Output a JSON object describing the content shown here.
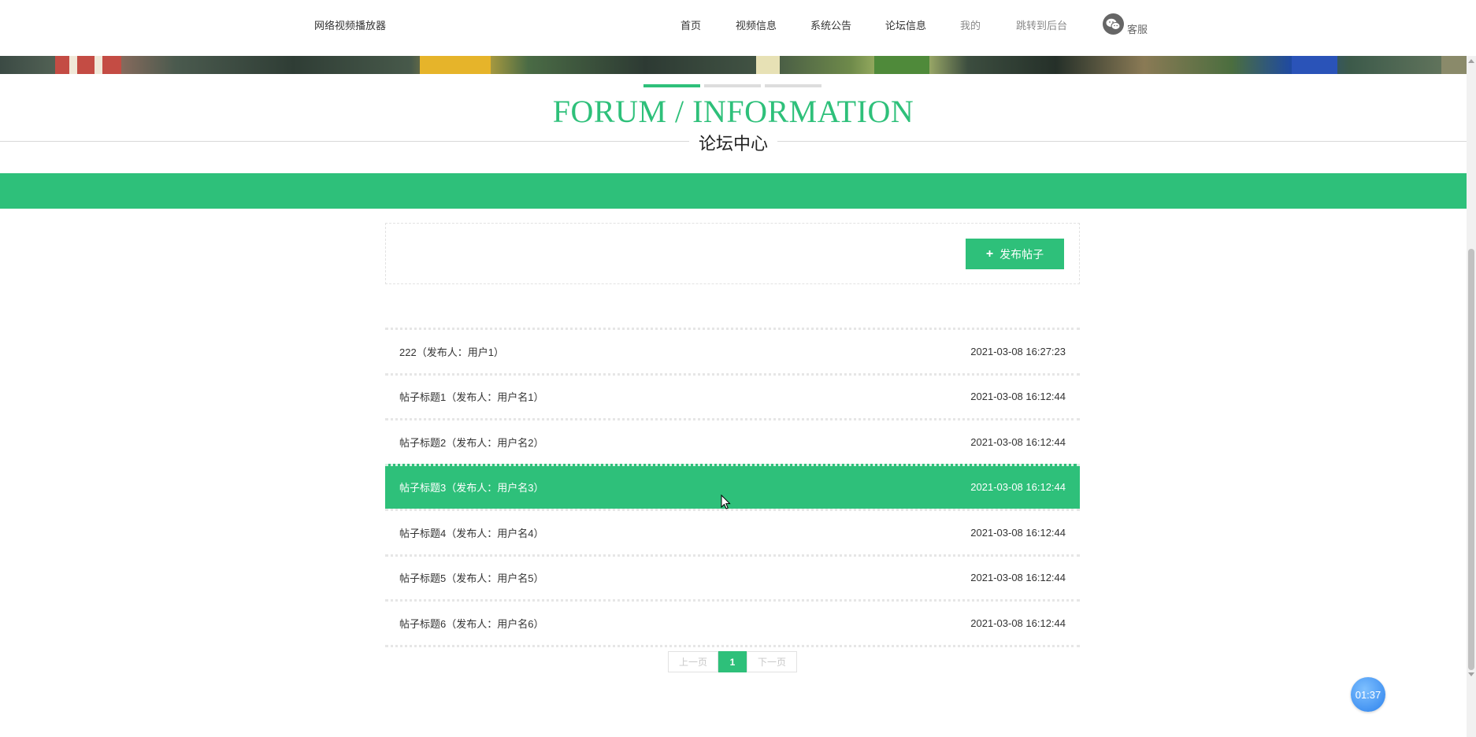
{
  "site": {
    "brand": "网络视频播放器"
  },
  "nav": {
    "items": [
      {
        "label": "首页"
      },
      {
        "label": "视频信息"
      },
      {
        "label": "系统公告"
      },
      {
        "label": "论坛信息"
      },
      {
        "label": "我的"
      },
      {
        "label": "跳转到后台"
      }
    ],
    "support_label": "客服"
  },
  "section": {
    "title_en": "FORUM / INFORMATION",
    "title_cn": "论坛中心"
  },
  "toolbar": {
    "publish_label": "发布帖子"
  },
  "posts": [
    {
      "title": "222（发布人：用户1）",
      "time": "2021-03-08 16:27:23"
    },
    {
      "title": "帖子标题1（发布人：用户名1）",
      "time": "2021-03-08 16:12:44"
    },
    {
      "title": "帖子标题2（发布人：用户名2）",
      "time": "2021-03-08 16:12:44"
    },
    {
      "title": "帖子标题3（发布人：用户名3）",
      "time": "2021-03-08 16:12:44"
    },
    {
      "title": "帖子标题4（发布人：用户名4）",
      "time": "2021-03-08 16:12:44"
    },
    {
      "title": "帖子标题5（发布人：用户名5）",
      "time": "2021-03-08 16:12:44"
    },
    {
      "title": "帖子标题6（发布人：用户名6）",
      "time": "2021-03-08 16:12:44"
    }
  ],
  "pagination": {
    "prev": "上一页",
    "current": "1",
    "next": "下一页"
  },
  "timer": "01:37",
  "colors": {
    "accent": "#2ec07a",
    "timer": "#3d8ef0"
  },
  "icons": {
    "support": "wechat-icon",
    "publish": "plus-icon"
  }
}
